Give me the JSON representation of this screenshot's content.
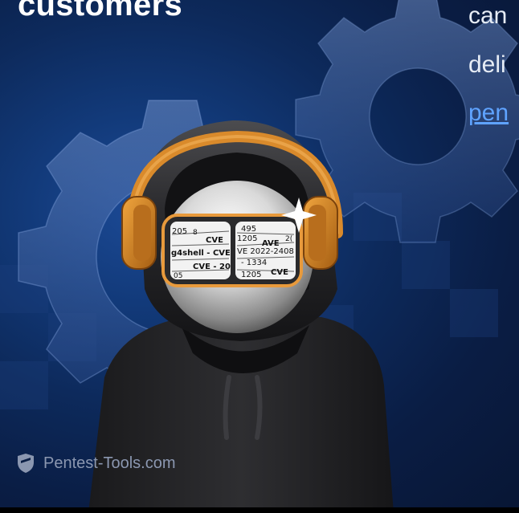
{
  "heading": "customers",
  "side_text": {
    "line1": "can",
    "line2": "deli",
    "link": "pen"
  },
  "visor_text": {
    "left": [
      "205",
      "8",
      "CVE",
      "g4shell - CVE",
      "CVE - 20",
      "05"
    ],
    "right": [
      "495",
      "1205",
      "AVE",
      "2(",
      "VE 2022-2408",
      "- 1334",
      "1205",
      "CVE"
    ]
  },
  "brand": {
    "name": "Pentest-Tools.com",
    "icon": "shield-icon"
  },
  "colors": {
    "background": "#0b1f45",
    "headphones": "#d98a2b",
    "link": "#5fa3ff"
  }
}
